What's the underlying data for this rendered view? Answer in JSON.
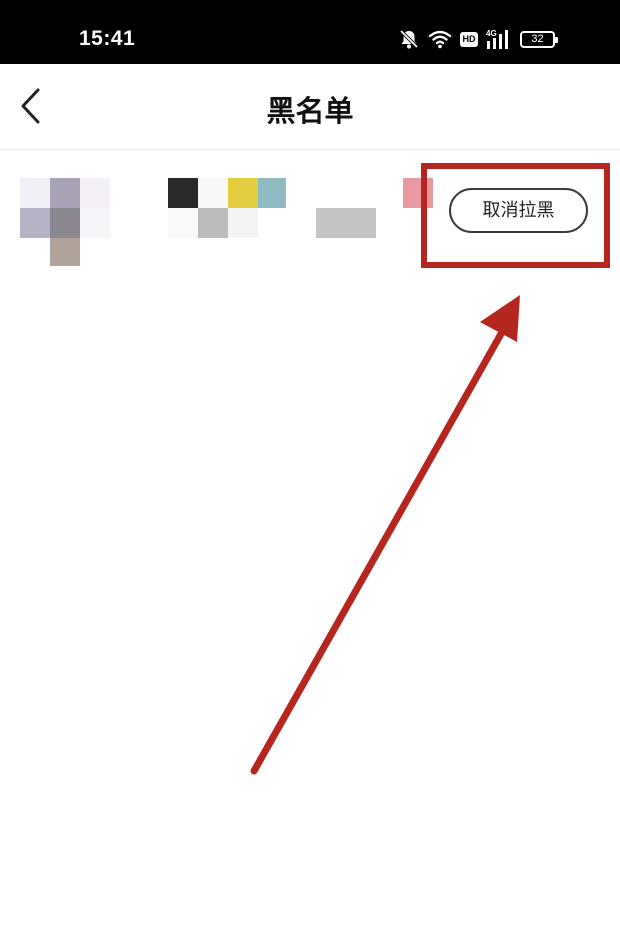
{
  "status_bar": {
    "time": "15:41",
    "icons": [
      "bell-muted-icon",
      "wifi-icon",
      "hd-badge",
      "cellular-4g-icon",
      "battery-icon"
    ],
    "hd_label": "HD",
    "network_label": "4G",
    "battery_level": "32"
  },
  "header": {
    "title": "黑名单",
    "back_icon": "chevron-left-icon"
  },
  "blacklist": {
    "items": [
      {
        "avatar": "pixelated-avatar",
        "name": "pixelated-name",
        "action_label": "取消拉黑"
      }
    ]
  },
  "annotation": {
    "highlight_color": "#b5261e",
    "arrow_color": "#b5261e"
  }
}
